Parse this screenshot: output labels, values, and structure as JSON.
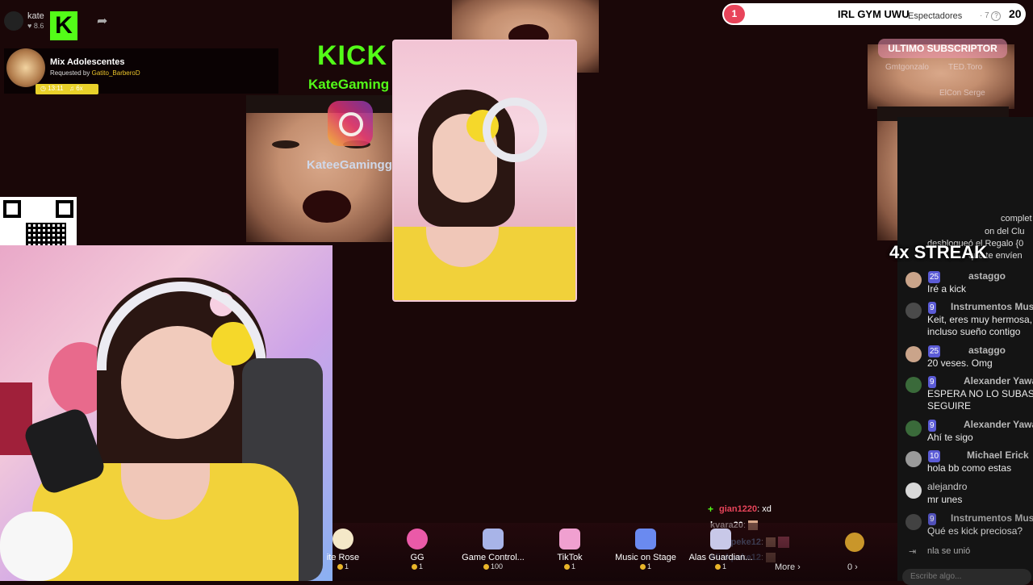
{
  "top_left": {
    "streamer": "kate",
    "viewers": "8.6"
  },
  "music": {
    "title": "Mix Adolescentes",
    "requested_prefix": "Requested by",
    "requested_by": "Gatito_BarberoD",
    "time": "13:11",
    "count": "6x"
  },
  "overlay": {
    "kick_logo": "KICK",
    "kick_handle": "KateGaming",
    "insta_handle": "KateeGamingg"
  },
  "goal": {
    "number": "1",
    "label": "IRL GYM UWU",
    "count": "20"
  },
  "viewers_panel": {
    "label": "Espectadores",
    "count": "7"
  },
  "subscriber": {
    "title": "ULTIMO SUBSCRIPTOR",
    "name1": "Gmtgonzalo",
    "name2": "TED.Toro",
    "name3": "ElCon Serge"
  },
  "streak": "4x STREAK",
  "chat": {
    "partial": [
      "complet",
      "on del Clu",
      "desbloqueó el Regalo {0",
      "que te envíen"
    ],
    "messages": [
      {
        "badge": "25",
        "name": "astaggo",
        "text": "Iré a kick"
      },
      {
        "badge": "9",
        "name": "Instrumentos Music",
        "text": "Keit, eres muy hermosa,",
        "text2": "incluso sueño contigo"
      },
      {
        "badge": "25",
        "name": "astaggo",
        "text": "20 veses. Omg"
      },
      {
        "badge": "9",
        "name": "Alexander Yawa",
        "text": "ESPERA NO LO SUBAS F",
        "text2": "SEGUIRE"
      },
      {
        "badge": "9",
        "name": "Alexander Yawa",
        "text": "Ahí te sigo"
      },
      {
        "badge": "10",
        "name": "Michael Erick",
        "text": "hola bb como estas"
      },
      {
        "badge": "",
        "name": "alejandro",
        "text": "mr unes"
      },
      {
        "badge": "9",
        "name": "Instrumentos Music",
        "text": "Qué es kick preciosa?"
      }
    ],
    "joined": "nla  se unió",
    "input_placeholder": "Escribe algo..."
  },
  "kick_chat": [
    {
      "name": "gian1220",
      "text": ": xd"
    },
    {
      "name": "kvara20",
      "text": ":"
    },
    {
      "name": "blinkpeke12",
      "text": ":"
    },
    {
      "name": "blinkpeke12",
      "text": ":"
    }
  ],
  "gifts": [
    {
      "label": "ite Rose",
      "cost": "1"
    },
    {
      "label": "GG",
      "cost": "1"
    },
    {
      "label": "Game Control...",
      "cost": "100"
    },
    {
      "label": "TikTok",
      "cost": "1"
    },
    {
      "label": "Music on Stage",
      "cost": "1"
    },
    {
      "label": "Alas Guardian...",
      "cost": "1"
    }
  ],
  "more_label": "More ›",
  "coins_label": "0 ›",
  "colors": {
    "kick_green": "#53fc18",
    "goal_red": "#e8445a",
    "badge_blue": "#5b5bd6"
  }
}
